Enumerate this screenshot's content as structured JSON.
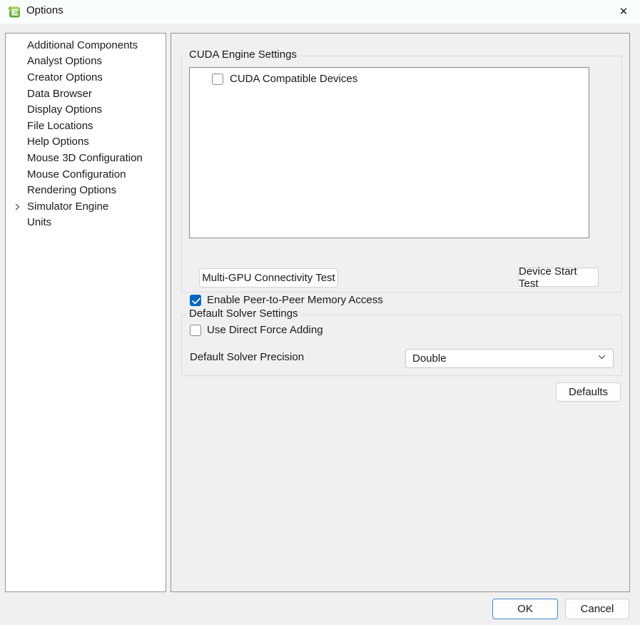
{
  "window": {
    "title": "Options",
    "icons": {
      "app_icon": "green-e-app-logo",
      "close_icon": "✕",
      "chevron_right_icon": "›",
      "chevron_down_icon": "⌄",
      "checkmark_icon": "✓"
    }
  },
  "colors": {
    "titlebar_bg": "#fafdfe",
    "content_bg": "#f0f0f0",
    "panel_border": "#949494",
    "group_border": "#dcdcdc",
    "accent_blue": "#0067c0",
    "ok_border_blue": "#4289cc",
    "icon_green": "#6cb33f"
  },
  "sidebar": {
    "items": [
      {
        "label": "Additional Components",
        "has_chevron": false
      },
      {
        "label": "Analyst Options",
        "has_chevron": false
      },
      {
        "label": "Creator Options",
        "has_chevron": false
      },
      {
        "label": "Data Browser",
        "has_chevron": false
      },
      {
        "label": "Display Options",
        "has_chevron": false
      },
      {
        "label": "File Locations",
        "has_chevron": false
      },
      {
        "label": "Help Options",
        "has_chevron": false
      },
      {
        "label": "Mouse 3D Configuration",
        "has_chevron": false
      },
      {
        "label": "Mouse Configuration",
        "has_chevron": false
      },
      {
        "label": "Rendering Options",
        "has_chevron": false
      },
      {
        "label": "Simulator Engine",
        "has_chevron": true
      },
      {
        "label": "Units",
        "has_chevron": false
      }
    ]
  },
  "main": {
    "cuda_group": {
      "title": "CUDA Engine Settings",
      "device_list": {
        "items": [
          {
            "label": "CUDA Compatible Devices",
            "checked": false
          }
        ]
      },
      "multi_gpu_button": "Multi-GPU Connectivity Test",
      "device_start_button": "Device Start Test",
      "peer_checkbox": {
        "label": "Enable Peer-to-Peer Memory Access",
        "checked": true
      }
    },
    "solver_group": {
      "title": "Default Solver Settings",
      "direct_force_checkbox": {
        "label": "Use Direct Force Adding",
        "checked": false
      },
      "precision_label": "Default Solver Precision",
      "precision_value": "Double"
    },
    "defaults_button": "Defaults"
  },
  "footer": {
    "ok_label": "OK",
    "cancel_label": "Cancel"
  }
}
